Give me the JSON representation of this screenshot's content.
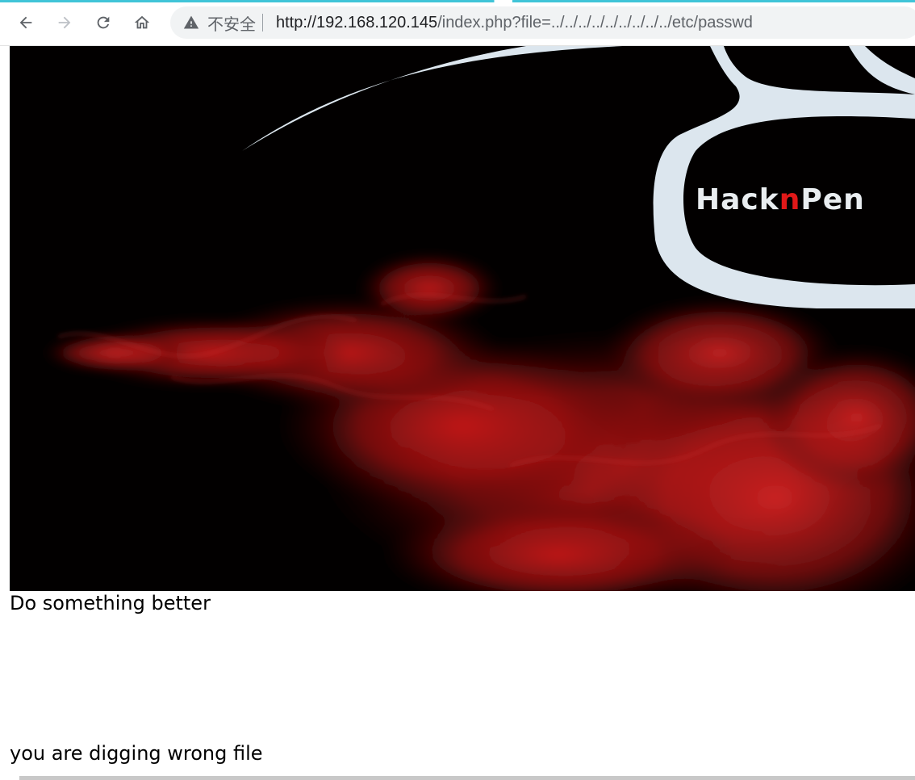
{
  "browser": {
    "security_label": "不安全",
    "url_host": "http://192.168.120.145",
    "url_path": "/index.php?file=../../../../../../../../../etc/passwd"
  },
  "banner": {
    "logo_text_prefix": "Hack",
    "logo_text_accent": "n",
    "logo_text_suffix": "Pen",
    "accent_color": "#e01818",
    "smoke_color": "#c41a1a",
    "swoosh_color": "#dce6ee"
  },
  "page": {
    "message_1": "Do something better",
    "message_2": "you are digging wrong file"
  }
}
